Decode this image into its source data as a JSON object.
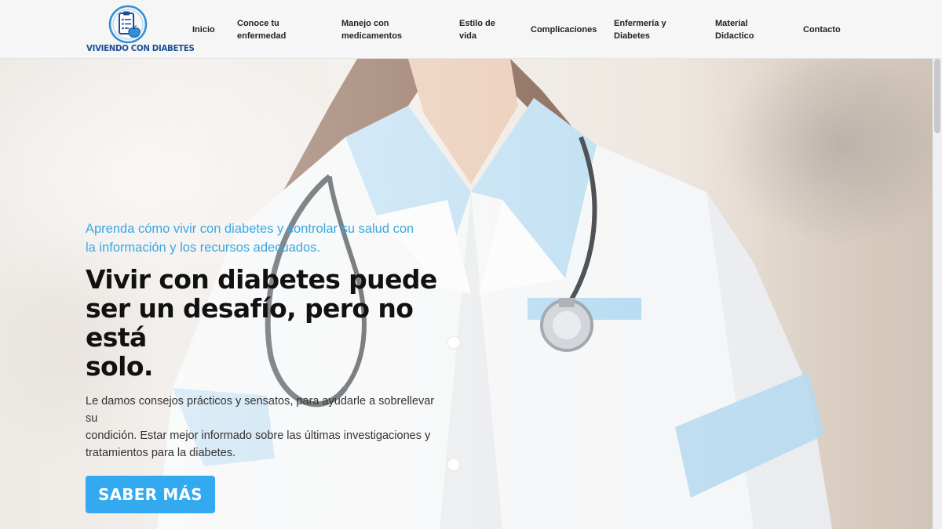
{
  "header": {
    "logo_text": "VIVIENDO CON DIABETES",
    "nav": [
      {
        "lines": [
          "Inicio"
        ]
      },
      {
        "lines": [
          "Conoce tu",
          "enfermedad"
        ]
      },
      {
        "lines": [
          "Manejo con",
          "medicamentos"
        ]
      },
      {
        "lines": [
          "Estilo de",
          "vida"
        ]
      },
      {
        "lines": [
          "Complicaciones"
        ]
      },
      {
        "lines": [
          "Enfermería y",
          "Diabetes"
        ]
      },
      {
        "lines": [
          "Material",
          "Didactico"
        ]
      },
      {
        "lines": [
          "Contacto"
        ]
      }
    ]
  },
  "hero": {
    "tagline_lines": [
      "Aprenda cómo vivir con diabetes y controlar su salud con",
      "la información y los recursos adecuados."
    ],
    "headline_lines": [
      "Vivir con diabetes puede",
      "ser un desafío, pero no está",
      "solo."
    ],
    "body_lines": [
      "Le damos consejos prácticos y sensatos, para ayudarle a sobrellevar su",
      "condición. Estar mejor informado sobre las últimas investigaciones y",
      "tratamientos para la diabetes."
    ],
    "cta_label": "SABER MÁS",
    "background_image": "doctor-in-white-coat-with-stethoscope"
  },
  "colors": {
    "accent": "#33aaf0",
    "tagline": "#3aa8e0",
    "logo": "#1d4f93",
    "header_bg": "#f6f6f6"
  }
}
